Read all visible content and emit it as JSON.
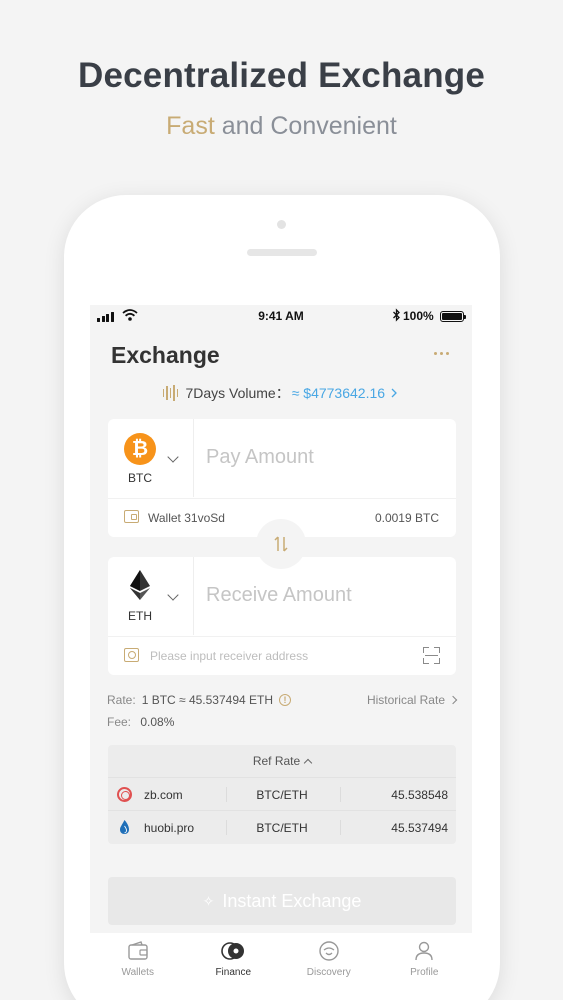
{
  "promo": {
    "headline": "Decentralized Exchange",
    "subline_accent": "Fast",
    "subline_rest": " and Convenient"
  },
  "status_bar": {
    "time": "9:41 AM",
    "battery": "100%"
  },
  "header": {
    "title": "Exchange"
  },
  "volume": {
    "label": "7Days Volume：",
    "value": "≈ $4773642.16"
  },
  "pay": {
    "coin": "BTC",
    "coin_glyph": "₿",
    "placeholder": "Pay Amount",
    "wallet_label": "Wallet 31voSd",
    "wallet_balance": "0.0019 BTC"
  },
  "receive": {
    "coin": "ETH",
    "placeholder": "Receive Amount",
    "address_placeholder": "Please input receiver address"
  },
  "rate": {
    "label": "Rate:",
    "value": "1 BTC ≈ 45.537494 ETH",
    "info_glyph": "!",
    "historical_label": "Historical Rate",
    "fee_label": "Fee:",
    "fee_value": "0.08%"
  },
  "ref_rate": {
    "title": "Ref Rate",
    "rows": [
      {
        "exchange": "zb.com",
        "pair": "BTC/ETH",
        "rate": "45.538548"
      },
      {
        "exchange": "huobi.pro",
        "pair": "BTC/ETH",
        "rate": "45.537494"
      }
    ]
  },
  "cta": {
    "label": "Instant Exchange"
  },
  "tabs": [
    {
      "label": "Wallets",
      "icon": "wallet-icon"
    },
    {
      "label": "Finance",
      "icon": "finance-icon",
      "active": true
    },
    {
      "label": "Discovery",
      "icon": "discovery-icon"
    },
    {
      "label": "Profile",
      "icon": "profile-icon"
    }
  ],
  "colors": {
    "accent_gold": "#c8ab74",
    "link_blue": "#49a7e4",
    "btc_orange": "#f7931a",
    "background": "#f4f4f4"
  }
}
